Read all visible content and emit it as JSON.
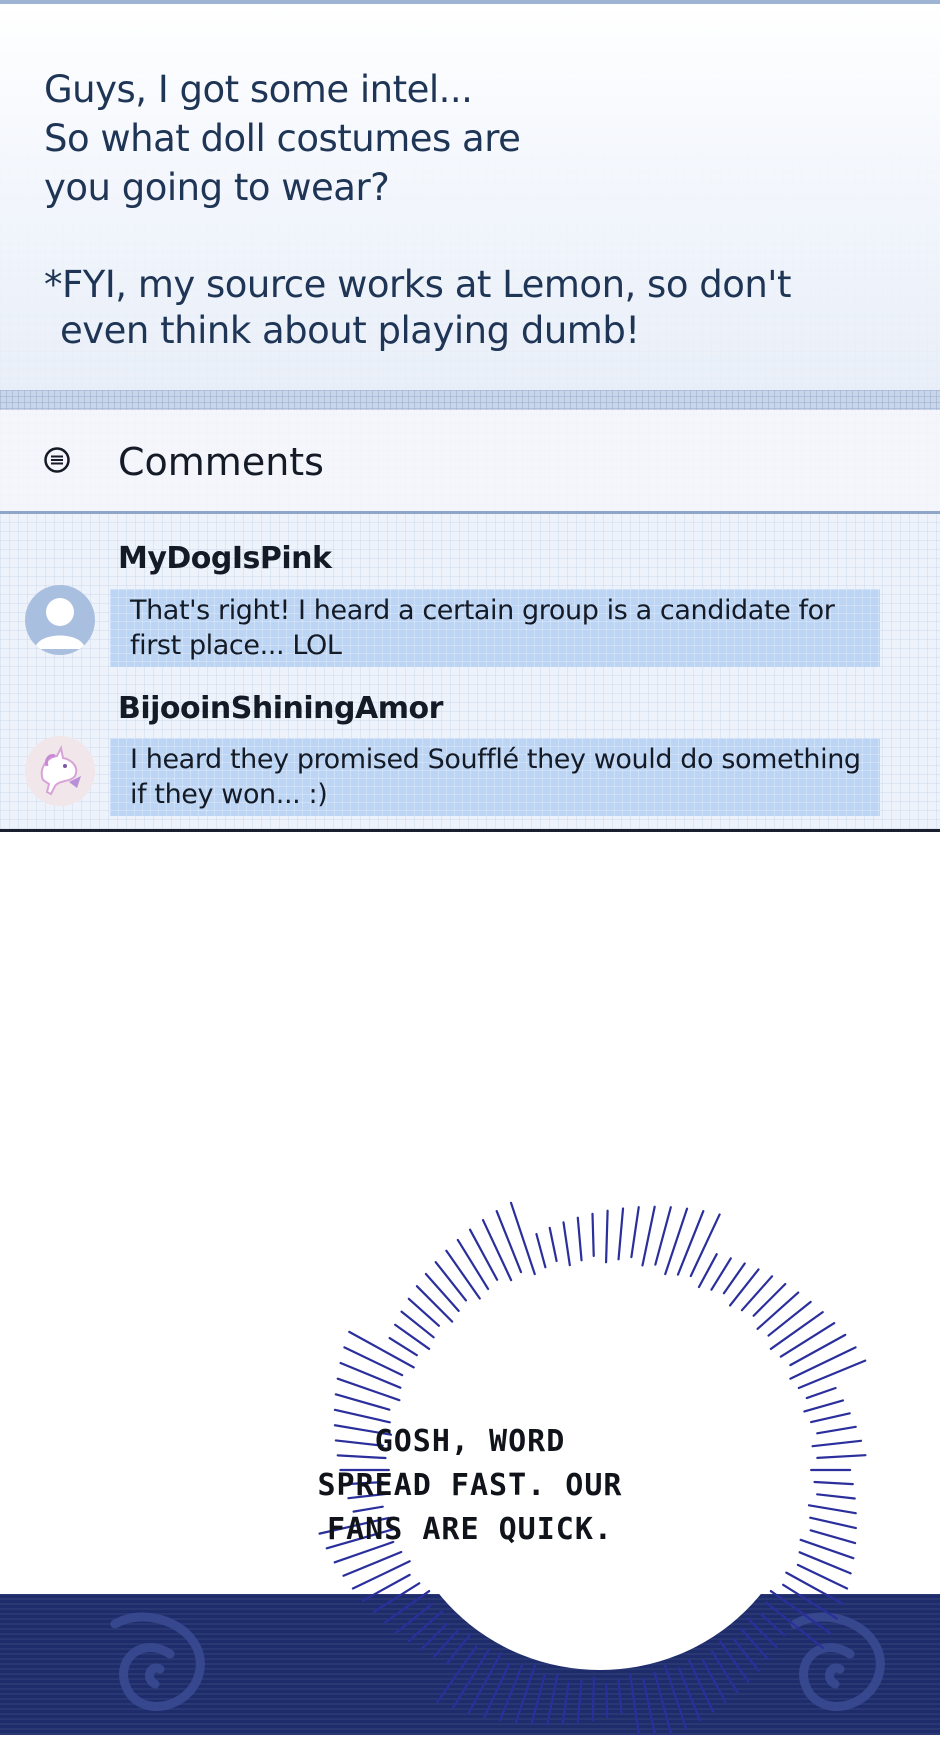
{
  "post": {
    "lines": [
      "Guys, I got some intel...",
      "So what doll costumes are",
      "you going to wear?",
      "*FYI, my source works at Lemon, so don't",
      "even think about playing dumb!"
    ]
  },
  "comments_section": {
    "title": "Comments",
    "icon": "comments-icon",
    "items": [
      {
        "username": "MyDogIsPink",
        "avatar": "default-user-avatar",
        "lines": [
          "That's right! I heard a certain group is a candidate for",
          "first place... LOL"
        ]
      },
      {
        "username": "BijooinShiningAmor",
        "avatar": "unicorn-avatar",
        "lines": [
          "I heard they promised Soufflé they would do something",
          "if they won... :)"
        ]
      }
    ]
  },
  "speech_burst": {
    "lines": [
      "GOSH, WORD",
      "SPREAD FAST. OUR",
      "FANS ARE QUICK."
    ]
  },
  "colors": {
    "post_text": "#1f3556",
    "bubble_fill": "#bcd5f4",
    "burst_lines": "#2a2f9c",
    "bottom_band": "#1e2c6b"
  }
}
